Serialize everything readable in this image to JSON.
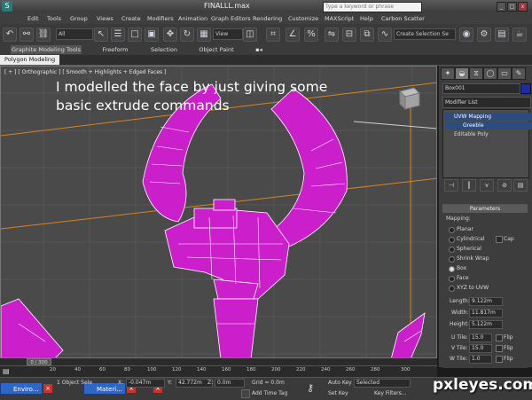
{
  "window": {
    "title": "FINALLL.max",
    "search_placeholder": "Type a keyword or phrase"
  },
  "menu": [
    "Edit",
    "Tools",
    "Group",
    "Views",
    "Create",
    "Modifiers",
    "Animation",
    "Graph Editors",
    "Rendering",
    "Customize",
    "MAXScript",
    "Help",
    "Carbon Scatter"
  ],
  "toolbar": {
    "selection_filter": "All",
    "ref_coord": "View",
    "named_selection": "Create Selection Se"
  },
  "ribbon": {
    "tabs": [
      "Graphite Modeling Tools",
      "Freeform",
      "Selection",
      "Object Paint"
    ],
    "active_tab": "Graphite Modeling Tools",
    "sub_label": "Polygon Modeling"
  },
  "viewport": {
    "label": "[ + ] [ Orthographic ] [ Smooth + Highlights + Edged Faces ]",
    "annotation_line1": "I modelled the face by just giving some",
    "annotation_line2": "basic extrude commands"
  },
  "command_panel": {
    "object_name": "Box001",
    "object_color": "#1f2aa8",
    "modifier_list": "Modifier List",
    "stack": [
      "UVW Mapping",
      "Greeble",
      "Editable Poly"
    ],
    "parameters_header": "Parameters",
    "mapping_label": "Mapping:",
    "mapping_options": [
      "Planar",
      "Cylindrical",
      "Spherical",
      "Shrink Wrap",
      "Box",
      "Face",
      "XYZ to UVW"
    ],
    "mapping_selected": "Box",
    "cap_label": "Cap",
    "length_label": "Length:",
    "length": "9.122m",
    "width_label": "Width:",
    "width": "11.817m",
    "height_label": "Height:",
    "height": "5.122m",
    "utile_label": "U Tile:",
    "utile": "15.0",
    "vtile_label": "V Tile:",
    "vtile": "15.0",
    "wtile_label": "W Tile:",
    "wtile": "1.0",
    "flip_label": "Flip"
  },
  "timeline": {
    "frame": "0 / 300",
    "ticks": [
      "20",
      "40",
      "60",
      "80",
      "100",
      "120",
      "140",
      "160",
      "180",
      "200",
      "220",
      "240",
      "260",
      "280",
      "300"
    ]
  },
  "status": {
    "task1": "Enviro...",
    "task2": "Materi...",
    "selected_text": "1 Object Sele",
    "x_label": "X:",
    "x_value": "-0.047m",
    "y_label": "Y:",
    "y_value": "42.772m",
    "z_label": "Z:",
    "z_value": "0.0m",
    "grid": "Grid = 0.0m",
    "add_time_tag": "Add Time Tag",
    "auto_key": "Auto Key",
    "set_key": "Set Key",
    "key_dropdown": "Selected",
    "key_filters": "Key Filters..."
  },
  "watermark": "pxleyes.com"
}
